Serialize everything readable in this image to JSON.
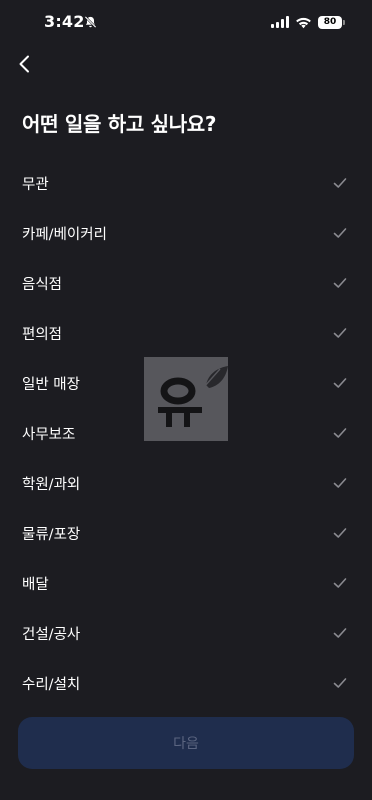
{
  "status": {
    "time": "3:42",
    "battery": "80"
  },
  "page": {
    "title": "어떤 일을 하고 싶나요?"
  },
  "job_types": [
    {
      "label": "무관"
    },
    {
      "label": "카페/베이커리"
    },
    {
      "label": "음식점"
    },
    {
      "label": "편의점"
    },
    {
      "label": "일반 매장"
    },
    {
      "label": "사무보조"
    },
    {
      "label": "학원/과외"
    },
    {
      "label": "물류/포장"
    },
    {
      "label": "배달"
    },
    {
      "label": "건설/공사"
    },
    {
      "label": "수리/설치"
    }
  ],
  "actions": {
    "next_label": "다음"
  },
  "watermark": {
    "text": "윤"
  },
  "colors": {
    "background": "#1c1c21",
    "check": "#8a8a90",
    "button_bg": "#1f2d4d",
    "button_text": "#5b6580"
  }
}
